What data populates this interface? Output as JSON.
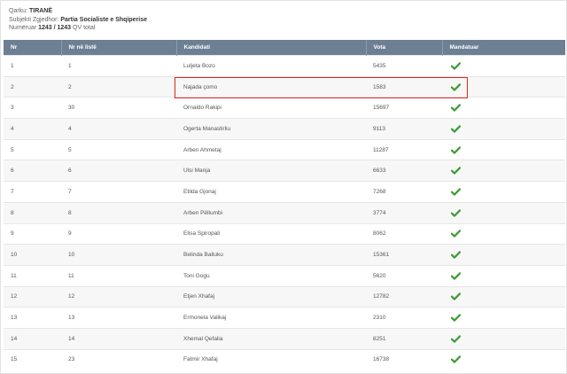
{
  "info": {
    "qarku_label": "Qarku:",
    "qarku_value": "TIRANË",
    "subjekti_label": "Subjekti Zgjedhor:",
    "subjekti_value": "Partia Socialiste e Shqiperise",
    "numeruar_label": "Numëruar",
    "numeruar_value": "1243 / 1243",
    "numeruar_suffix": "QV total"
  },
  "table": {
    "headers": [
      "Nr",
      "Nr në listë",
      "Kandidati",
      "Vota",
      "Mandatuar"
    ],
    "rows": [
      {
        "nr": "1",
        "nr_liste": "1",
        "kandidati": "Luljeta Bozo",
        "vota": "5435",
        "mandatuar": true
      },
      {
        "nr": "2",
        "nr_liste": "2",
        "kandidati": "Najada çomo",
        "vota": "1583",
        "mandatuar": true
      },
      {
        "nr": "3",
        "nr_liste": "30",
        "kandidati": "Ornaldo Rakipi",
        "vota": "15697",
        "mandatuar": true
      },
      {
        "nr": "4",
        "nr_liste": "4",
        "kandidati": "Ogerta Manastirliu",
        "vota": "9113",
        "mandatuar": true
      },
      {
        "nr": "5",
        "nr_liste": "5",
        "kandidati": "Arben Ahmetaj",
        "vota": "11287",
        "mandatuar": true
      },
      {
        "nr": "6",
        "nr_liste": "6",
        "kandidati": "Ulsi Manja",
        "vota": "6633",
        "mandatuar": true
      },
      {
        "nr": "7",
        "nr_liste": "7",
        "kandidati": "Etilda Gjonaj",
        "vota": "7268",
        "mandatuar": true
      },
      {
        "nr": "8",
        "nr_liste": "8",
        "kandidati": "Arben Pëllumbi",
        "vota": "3774",
        "mandatuar": true
      },
      {
        "nr": "9",
        "nr_liste": "9",
        "kandidati": "Elisa Spiropali",
        "vota": "8062",
        "mandatuar": true
      },
      {
        "nr": "10",
        "nr_liste": "10",
        "kandidati": "Belinda Balluku",
        "vota": "15361",
        "mandatuar": true
      },
      {
        "nr": "11",
        "nr_liste": "11",
        "kandidati": "Toni Gogu",
        "vota": "5620",
        "mandatuar": true
      },
      {
        "nr": "12",
        "nr_liste": "12",
        "kandidati": "Etjen Xhafaj",
        "vota": "12782",
        "mandatuar": true
      },
      {
        "nr": "13",
        "nr_liste": "13",
        "kandidati": "Ermonela Valikaj",
        "vota": "2310",
        "mandatuar": true
      },
      {
        "nr": "14",
        "nr_liste": "14",
        "kandidati": "Xhemal Qefalia",
        "vota": "8251",
        "mandatuar": true
      },
      {
        "nr": "15",
        "nr_liste": "23",
        "kandidati": "Fatmir Xhafaj",
        "vota": "16738",
        "mandatuar": true
      }
    ]
  },
  "colors": {
    "header_bg": "#6d7f93",
    "check_green": "#3c9a35",
    "highlight_red": "#e32424"
  },
  "icons": {
    "mandatuar": "check-icon"
  },
  "highlight": {
    "row_nr": "2"
  }
}
